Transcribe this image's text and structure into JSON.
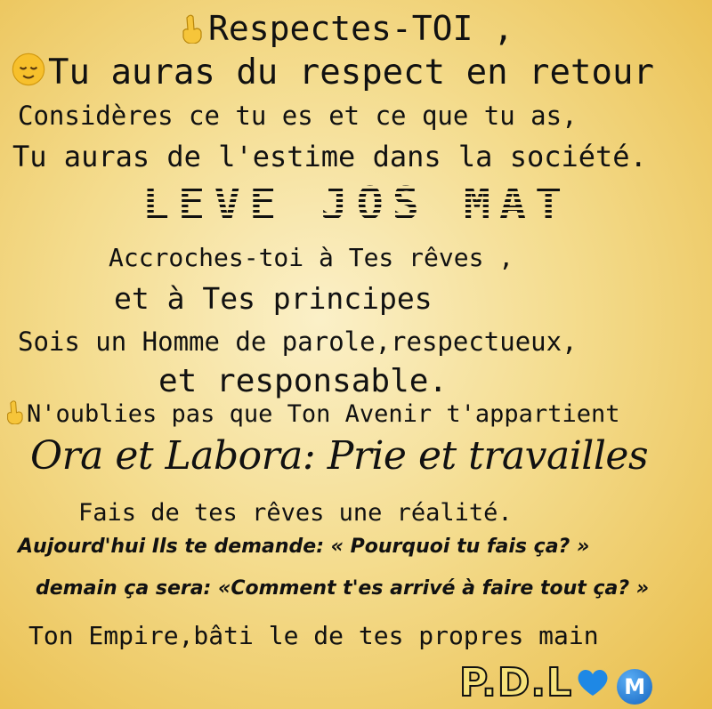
{
  "lines": {
    "l1": "Respectes-TOI ,",
    "l2": "Tu auras du respect en retour",
    "l3": "Considères ce tu es et ce que tu as,",
    "l4": "Tu auras de l'estime dans la société.",
    "title": "LEVE JOS MAT",
    "l5": "Accroches-toi à Tes rêves ,",
    "l6": "et à Tes principes",
    "l7": "Sois un Homme de parole,respectueux,",
    "l8": "et responsable.",
    "l9": "N'oublies pas que Ton Avenir t'appartient",
    "motto": "Ora et Labora: Prie et travailles",
    "l10": "Fais de tes rêves une réalité.",
    "l11": "Aujourd'hui Ils te demande:  « Pourquoi tu fais ça? »",
    "l12": "demain ça sera: «Comment t'es arrivé à faire tout ça? »",
    "l13": "Ton Empire,bâti le de tes propres main"
  },
  "signature": {
    "initials": "P.D.L",
    "badge": "M"
  },
  "icons": {
    "pointing": "pointing-up-icon",
    "smile": "relieved-face-icon",
    "heart": "blue-heart-icon",
    "badge": "m-circle-icon"
  },
  "colors": {
    "heart": "#1e88e5",
    "badge": "#1565c0"
  }
}
